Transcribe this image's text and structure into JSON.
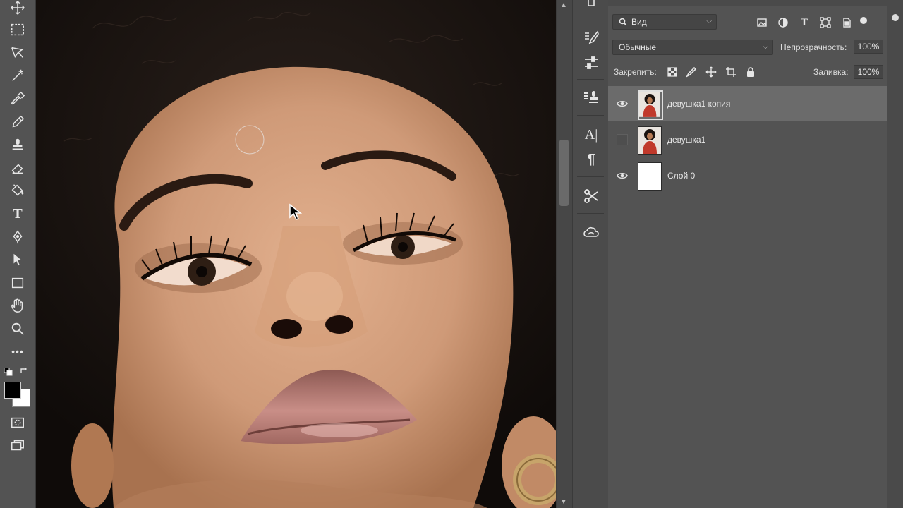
{
  "app": "Adobe Photoshop",
  "toolbar": {
    "tools": [
      "move-icon",
      "marquee-icon",
      "lasso-icon",
      "quick-select-icon",
      "eyedropper-icon",
      "brush-icon",
      "stamp-icon",
      "eraser-icon",
      "paint-bucket-icon",
      "type-icon",
      "pen-icon",
      "path-select-icon",
      "rectangle-icon",
      "hand-icon",
      "zoom-icon",
      "more-icon"
    ],
    "type_glyph": "T",
    "more_glyph": "•••",
    "foreground_color": "#000000",
    "background_color": "#ffffff"
  },
  "dock": {
    "items": [
      "brush-settings-icon",
      "adjustments-icon",
      "clone-source-icon",
      "character-icon",
      "paragraph-icon",
      "tool-presets-icon",
      "libraries-icon"
    ],
    "character_glyph": "A|",
    "paragraph_glyph": "¶"
  },
  "layers_panel": {
    "filter": {
      "label": "Вид"
    },
    "blend_mode": "Обычные",
    "opacity_label": "Непрозрачность:",
    "opacity_value": "100%",
    "lock_label": "Закрепить:",
    "fill_label": "Заливка:",
    "fill_value": "100%",
    "layers": [
      {
        "name": "девушка1 копия",
        "visible": true,
        "selected": true,
        "thumb": "photo"
      },
      {
        "name": "девушка1",
        "visible": false,
        "selected": false,
        "thumb": "photo"
      },
      {
        "name": "Слой 0",
        "visible": true,
        "selected": false,
        "thumb": "white"
      }
    ]
  },
  "colors": {
    "ui_bg": "#535353",
    "selected_layer": "#6b6b6b"
  }
}
